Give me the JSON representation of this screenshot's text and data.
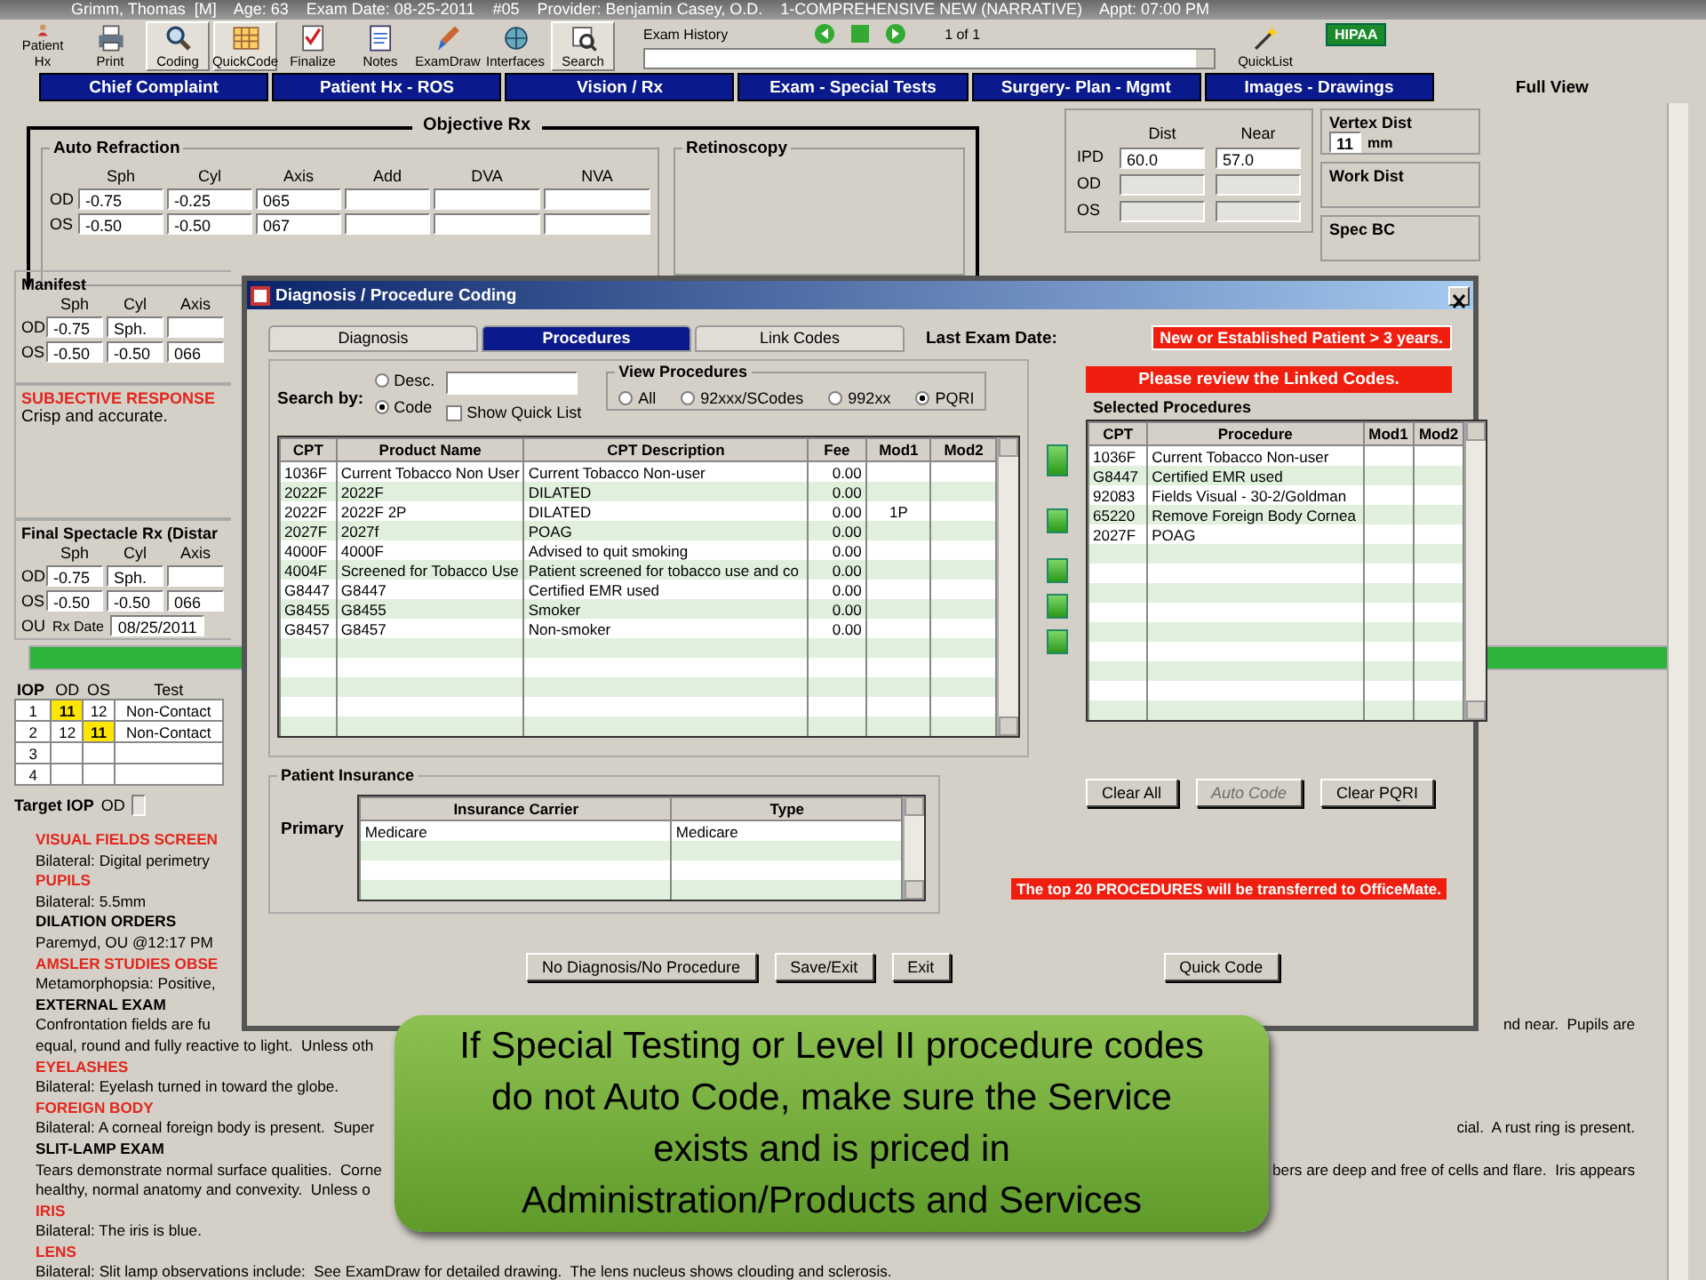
{
  "title_bar": {
    "text": "Grimm, Thomas  [M]    Age: 63    Exam Date: 08-25-2011    #05    Provider: Benjamin Casey, O.D.    1-COMPREHENSIVE NEW (NARRATIVE)    Appt: 07:00 PM"
  },
  "toolbar": {
    "tools": [
      {
        "label": "Patient Hx",
        "pressed": false
      },
      {
        "label": "Print",
        "pressed": false
      },
      {
        "label": "Coding",
        "pressed": true
      },
      {
        "label": "QuickCode",
        "pressed": true
      },
      {
        "label": "Finalize",
        "pressed": false
      },
      {
        "label": "Notes",
        "pressed": false
      },
      {
        "label": "ExamDraw",
        "pressed": false
      },
      {
        "label": "Interfaces",
        "pressed": false
      },
      {
        "label": "Search",
        "pressed": true
      }
    ],
    "exam_history": {
      "label": "Exam History",
      "counter": "1 of 1"
    },
    "quicklist": {
      "label": "QuickList"
    },
    "badge": "HIPAA"
  },
  "tabs": [
    {
      "label": "Chief Complaint",
      "selected": false
    },
    {
      "label": "Patient Hx - ROS",
      "selected": false
    },
    {
      "label": "Vision / Rx",
      "selected": false
    },
    {
      "label": "Exam - Special Tests",
      "selected": false
    },
    {
      "label": "Surgery- Plan - Mgmt",
      "selected": false
    },
    {
      "label": "Images - Drawings",
      "selected": false
    },
    {
      "label": "Full View",
      "selected": true
    }
  ],
  "objective_rx": {
    "title": "Objective Rx",
    "auto_refraction": {
      "title": "Auto Refraction",
      "columns": [
        "Sph",
        "Cyl",
        "Axis",
        "Add",
        "DVA",
        "NVA"
      ],
      "rows": [
        {
          "eye": "OD",
          "values": [
            "-0.75",
            "-0.25",
            "065"
          ]
        },
        {
          "eye": "OS",
          "values": [
            "-0.50",
            "-0.50",
            "067"
          ]
        }
      ]
    },
    "retinoscopy": {
      "title": "Retinoscopy"
    }
  },
  "pd": {
    "columns": [
      "Dist",
      "Near"
    ],
    "rows": [
      {
        "label": "IPD",
        "values": [
          "60.0",
          "57.0"
        ]
      },
      {
        "label": "OD"
      },
      {
        "label": "OS"
      }
    ]
  },
  "vertex": {
    "title": "Vertex Dist",
    "value": "11",
    "unit": "mm"
  },
  "work_dist": {
    "title": "Work Dist"
  },
  "spec_bc": {
    "title": "Spec BC"
  },
  "manifest": {
    "title": "Manifest",
    "columns": [
      "Sph",
      "Cyl",
      "Axis"
    ],
    "rows": [
      {
        "eye": "OD",
        "values": [
          "-0.75",
          "Sph."
        ]
      },
      {
        "eye": "OS",
        "values": [
          "-0.50",
          "-0.50",
          "066"
        ]
      }
    ]
  },
  "subjective": {
    "title": "SUBJECTIVE RESPONSE",
    "text": "Crisp and accurate."
  },
  "final_rx": {
    "title": "Final Spectacle Rx (Distar",
    "columns": [
      "Sph",
      "Cyl",
      "Axis"
    ],
    "rows": [
      {
        "eye": "OD",
        "values": [
          "-0.75",
          "Sph."
        ]
      },
      {
        "eye": "OS",
        "values": [
          "-0.50",
          "-0.50",
          "066"
        ]
      }
    ],
    "ou_label": "OU",
    "date_label": "Rx Date",
    "date": "08/25/2011"
  },
  "iop": {
    "columns": [
      "IOP",
      "OD",
      "OS",
      "Test"
    ],
    "rows": [
      {
        "num": "1",
        "od": {
          "value": "11",
          "flagged": true
        },
        "os": {
          "value": "12",
          "flagged": false
        },
        "test": "Non-Contact"
      },
      {
        "num": "2",
        "od": {
          "value": "12",
          "flagged": false
        },
        "os": {
          "value": "11",
          "flagged": true
        },
        "test": "Non-Contact"
      },
      {
        "num": "3"
      },
      {
        "num": "4"
      }
    ],
    "target_label": "Target IOP",
    "target_eye": "OD"
  },
  "notes": [
    {
      "heading": "VISUAL FIELDS SCREEN",
      "color": "#e3261c",
      "lines": [
        {
          "left": "Bilateral: Digital perimetry"
        }
      ]
    },
    {
      "heading": "PUPILS",
      "color": "#e3261c",
      "lines": [
        {
          "left": "Bilateral: 5.5mm"
        }
      ]
    },
    {
      "heading": "DILATION ORDERS",
      "color": "#000000",
      "lines": [
        {
          "left": "Paremyd, OU @12:17 PM"
        }
      ]
    },
    {
      "heading": "AMSLER STUDIES OBSE",
      "color": "#e3261c",
      "lines": [
        {
          "left": "Metamorphopsia: Positive,"
        }
      ]
    },
    {
      "heading": "EXTERNAL EXAM",
      "color": "#000000",
      "lines": [
        {
          "left": "Confrontation fields are fu",
          "right": "nd near.  Pupils are"
        },
        {
          "left": "equal, round and fully reactive to light.  Unless oth"
        }
      ]
    },
    {
      "heading": "EYELASHES",
      "color": "#e3261c",
      "lines": [
        {
          "left": "Bilateral: Eyelash turned in toward the globe."
        }
      ]
    },
    {
      "heading": "FOREIGN BODY",
      "color": "#e3261c",
      "lines": [
        {
          "left": "Bilateral: A corneal foreign body is present.  Super",
          "right": "cial.  A rust ring is present."
        }
      ]
    },
    {
      "heading": "SLIT-LAMP EXAM",
      "color": "#000000",
      "lines": [
        {
          "left": "Tears demonstrate normal surface qualities.  Corne",
          "right": "bers are deep and free of cells and flare.  Iris appears"
        },
        {
          "left": "healthy, normal anatomy and convexity.  Unless o"
        }
      ]
    },
    {
      "heading": "IRIS",
      "color": "#e3261c",
      "lines": [
        {
          "left": "Bilateral: The iris is blue."
        }
      ]
    },
    {
      "heading": "LENS",
      "color": "#e3261c",
      "lines": [
        {
          "left": "Bilateral: Slit lamp observations include:  See ExamDraw for detailed drawing.  The lens nucleus shows clouding and sclerosis."
        }
      ]
    }
  ],
  "dialog": {
    "title": "Diagnosis / Procedure Coding",
    "tabs": [
      {
        "label": "Diagnosis",
        "selected": false
      },
      {
        "label": "Procedures",
        "selected": true
      },
      {
        "label": "Link Codes",
        "selected": false
      }
    ],
    "last_exam_label": "Last Exam Date:",
    "patient_status": "New or Established Patient > 3 years.",
    "search": {
      "label": "Search by:",
      "options": [
        {
          "label": "Desc.",
          "selected": false
        },
        {
          "label": "Code",
          "selected": true
        }
      ],
      "quick_list": {
        "label": "Show Quick List",
        "checked": false
      }
    },
    "view_procedures": {
      "title": "View Procedures",
      "options": [
        {
          "label": "All",
          "selected": false
        },
        {
          "label": "92xxx/SCodes",
          "selected": false
        },
        {
          "label": "992xx",
          "selected": false
        },
        {
          "label": "PQRI",
          "selected": true
        }
      ]
    },
    "procedures": {
      "columns": [
        "CPT",
        "Product Name",
        "CPT Description",
        "Fee",
        "Mod1",
        "Mod2"
      ],
      "rows": [
        [
          "1036F",
          "Current Tobacco Non User",
          "Current Tobacco Non-user",
          "0.00"
        ],
        [
          "2022F",
          "2022F",
          "DILATED",
          "0.00"
        ],
        [
          "2022F",
          "2022F 2P",
          "DILATED",
          "0.00",
          "1P"
        ],
        [
          "2027F",
          "2027f",
          "POAG",
          "0.00"
        ],
        [
          "4000F",
          "4000F",
          "Advised to quit smoking",
          "0.00"
        ],
        [
          "4004F",
          "Screened for Tobacco Use",
          "Patient screened for tobacco use and co",
          "0.00"
        ],
        [
          "G8447",
          "G8447",
          "Certified EMR used",
          "0.00"
        ],
        [
          "G8455",
          "G8455",
          "Smoker",
          "0.00"
        ],
        [
          "G8457",
          "G8457",
          "Non-smoker",
          "0.00"
        ]
      ]
    },
    "review_notice": "Please review the Linked Codes.",
    "selected_procedures": {
      "title": "Selected Procedures",
      "columns": [
        "CPT",
        "Procedure",
        "Mod1",
        "Mod2"
      ],
      "rows": [
        [
          "1036F",
          "Current Tobacco Non-user"
        ],
        [
          "G8447",
          "Certified EMR used"
        ],
        [
          "92083",
          "Fields Visual - 30-2/Goldman"
        ],
        [
          "65220",
          "Remove Foreign Body Cornea"
        ],
        [
          "2027F",
          "POAG"
        ]
      ],
      "buttons": [
        {
          "label": "Clear All",
          "disabled": false
        },
        {
          "label": "Auto Code",
          "disabled": true
        },
        {
          "label": "Clear PQRI",
          "disabled": false
        }
      ]
    },
    "insurance": {
      "title": "Patient Insurance",
      "row_label": "Primary",
      "columns": [
        "Insurance Carrier",
        "Type"
      ],
      "rows": [
        [
          "Medicare",
          "Medicare"
        ]
      ]
    },
    "transfer_notice": "The top 20 PROCEDURES will be transferred to OfficeMate.",
    "buttons": [
      "No Diagnosis/No Procedure",
      "Save/Exit",
      "Exit",
      "Quick Code"
    ]
  },
  "callout": {
    "text": "If Special Testing or Level II procedure codes do not Auto Code, make sure the Service exists and is priced in Administration/Products and Services"
  }
}
